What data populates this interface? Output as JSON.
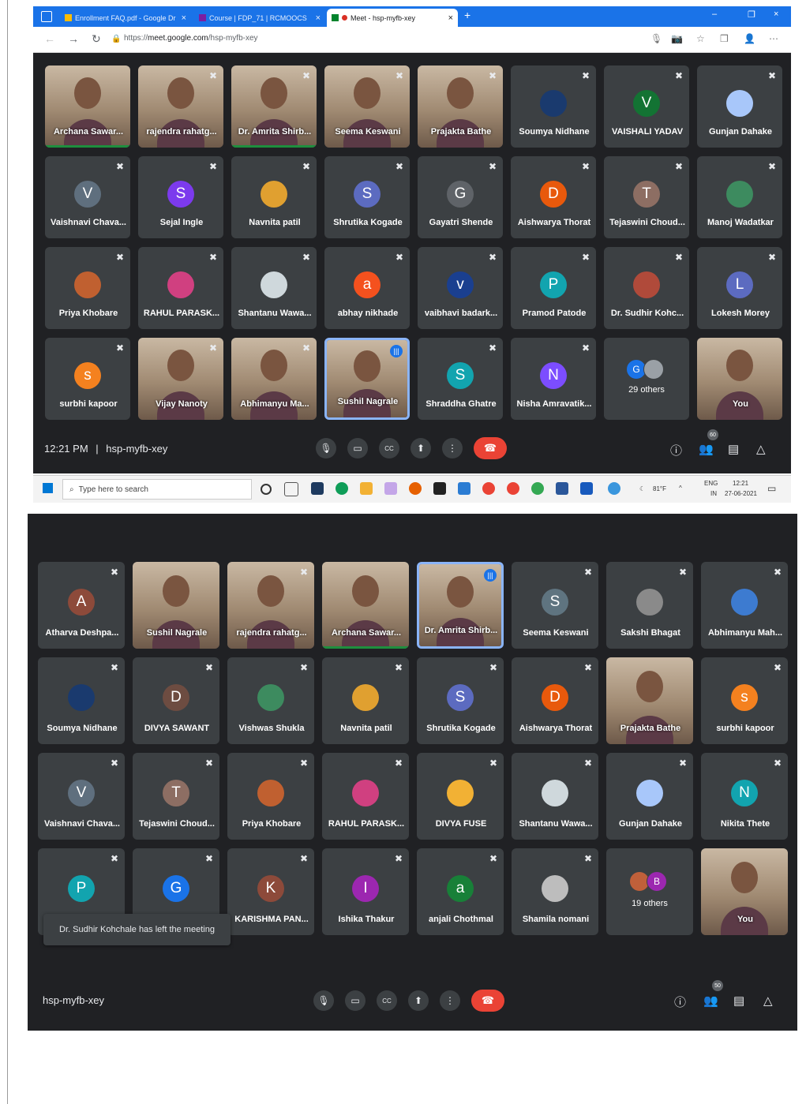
{
  "screenshot1": {
    "tabs": [
      {
        "label": "Enrollment FAQ.pdf - Google Dr",
        "close": "×"
      },
      {
        "label": "Course | FDP_71 | RCMOOCS",
        "close": "×"
      },
      {
        "label": "Meet - hsp-myfb-xey",
        "close": "×"
      }
    ],
    "new_tab": "+",
    "window_controls": [
      "–",
      "❐",
      "×"
    ],
    "url_prefix": "https://",
    "url_host": "meet.google.com",
    "url_path": "/hsp-myfb-xey",
    "tiles": [
      {
        "name": "Archana Sawar...",
        "type": "video",
        "green": true
      },
      {
        "name": "rajendra rahatg...",
        "type": "video",
        "muted": true
      },
      {
        "name": "Dr. Amrita Shirb...",
        "type": "video",
        "muted": true,
        "green": true
      },
      {
        "name": "Seema Keswani",
        "type": "video",
        "muted": true
      },
      {
        "name": "Prajakta Bathe",
        "type": "video",
        "muted": true
      },
      {
        "name": "Soumya Nidhane",
        "initial": "",
        "color": "#1a3a6e",
        "muted": true
      },
      {
        "name": "VAISHALI YADAV",
        "initial": "V",
        "color": "#137333",
        "muted": true
      },
      {
        "name": "Gunjan Dahake",
        "initial": "",
        "color": "#a8c7fa",
        "muted": true
      },
      {
        "name": "Vaishnavi Chava...",
        "initial": "V",
        "color": "#5f6f7e",
        "muted": true
      },
      {
        "name": "Sejal Ingle",
        "initial": "S",
        "color": "#7c3aed",
        "muted": true
      },
      {
        "name": "Navnita patil",
        "initial": "",
        "color": "#e0a030",
        "muted": true
      },
      {
        "name": "Shrutika Kogade",
        "initial": "S",
        "color": "#5c6bc0",
        "muted": true
      },
      {
        "name": "Gayatri Shende",
        "initial": "G",
        "color": "#5f6368",
        "muted": true
      },
      {
        "name": "Aishwarya Thorat",
        "initial": "D",
        "color": "#e8590c",
        "muted": true
      },
      {
        "name": "Tejaswini Choud...",
        "initial": "T",
        "color": "#8d6e63",
        "muted": true
      },
      {
        "name": "Manoj Wadatkar",
        "initial": "",
        "color": "#3d8b5f",
        "muted": true
      },
      {
        "name": "Priya Khobare",
        "initial": "",
        "color": "#c06030",
        "muted": true
      },
      {
        "name": "RAHUL PARASK...",
        "initial": "",
        "color": "#d04080",
        "muted": true
      },
      {
        "name": "Shantanu Wawa...",
        "initial": "",
        "color": "#cfd8dc",
        "muted": true
      },
      {
        "name": "abhay nikhade",
        "initial": "a",
        "color": "#f4511e",
        "muted": true
      },
      {
        "name": "vaibhavi badark...",
        "initial": "v",
        "color": "#1a3f8f",
        "muted": true
      },
      {
        "name": "Pramod Patode",
        "initial": "P",
        "color": "#12a4af",
        "muted": true
      },
      {
        "name": "Dr. Sudhir Kohc...",
        "initial": "",
        "color": "#b04a3a",
        "muted": true
      },
      {
        "name": "Lokesh Morey",
        "initial": "L",
        "color": "#5c6bc0",
        "muted": true
      },
      {
        "name": "surbhi kapoor",
        "initial": "s",
        "color": "#f4811f",
        "muted": true
      },
      {
        "name": "Vijay Nanoty",
        "type": "video",
        "muted": true
      },
      {
        "name": "Abhimanyu Ma...",
        "type": "video",
        "muted": true
      },
      {
        "name": "Sushil Nagrale",
        "type": "video",
        "speaking": true
      },
      {
        "name": "Shraddha Ghatre",
        "initial": "S",
        "color": "#12a4af",
        "muted": true
      },
      {
        "name": "Nisha Amravatik...",
        "initial": "N",
        "color": "#7c4dff",
        "muted": true
      },
      {
        "name": "29 others",
        "type": "others",
        "avatars": [
          {
            "letter": "G",
            "color": "#1a73e8"
          },
          {
            "letter": "",
            "color": "#9aa0a6"
          }
        ]
      },
      {
        "name": "You",
        "type": "video"
      }
    ],
    "time": "12:21 PM",
    "separator": "|",
    "meeting_code": "hsp-myfb-xey",
    "participant_count": "60",
    "taskbar": {
      "search_placeholder": "Type here to search",
      "weather": "81°F",
      "lang": "ENG",
      "region": "IN",
      "clock_time": "12:21",
      "clock_date": "27-06-2021"
    }
  },
  "screenshot2": {
    "tiles": [
      {
        "name": "Atharva Deshpa...",
        "initial": "A",
        "color": "#8d4a3a",
        "muted": true
      },
      {
        "name": "Sushil Nagrale",
        "type": "video"
      },
      {
        "name": "rajendra rahatg...",
        "type": "video",
        "muted": true
      },
      {
        "name": "Archana Sawar...",
        "type": "video",
        "green": true
      },
      {
        "name": "Dr. Amrita Shirb...",
        "type": "video",
        "speaking": true
      },
      {
        "name": "Seema Keswani",
        "initial": "S",
        "color": "#5f7480",
        "muted": true
      },
      {
        "name": "Sakshi Bhagat",
        "initial": "",
        "color": "#8a8a8a",
        "muted": true
      },
      {
        "name": "Abhimanyu Mah...",
        "initial": "",
        "color": "#3d7bd0",
        "muted": true
      },
      {
        "name": "Soumya Nidhane",
        "initial": "",
        "color": "#1a3a6e",
        "muted": true
      },
      {
        "name": "DIVYA SAWANT",
        "initial": "D",
        "color": "#6d4c41",
        "muted": true
      },
      {
        "name": "Vishwas Shukla",
        "initial": "",
        "color": "#3d8b5f",
        "muted": true
      },
      {
        "name": "Navnita patil",
        "initial": "",
        "color": "#e0a030",
        "muted": true
      },
      {
        "name": "Shrutika Kogade",
        "initial": "S",
        "color": "#5c6bc0",
        "muted": true
      },
      {
        "name": "Aishwarya Thorat",
        "initial": "D",
        "color": "#e8590c",
        "muted": true
      },
      {
        "name": "Prajakta Bathe",
        "type": "video"
      },
      {
        "name": "surbhi kapoor",
        "initial": "s",
        "color": "#f4811f",
        "muted": true
      },
      {
        "name": "Vaishnavi Chava...",
        "initial": "V",
        "color": "#5f6f7e",
        "muted": true
      },
      {
        "name": "Tejaswini Choud...",
        "initial": "T",
        "color": "#8d6e63",
        "muted": true
      },
      {
        "name": "Priya Khobare",
        "initial": "",
        "color": "#c06030",
        "muted": true
      },
      {
        "name": "RAHUL PARASK...",
        "initial": "",
        "color": "#d04080",
        "muted": true
      },
      {
        "name": "DIVYA FUSE",
        "initial": "",
        "color": "#f2b134",
        "muted": true
      },
      {
        "name": "Shantanu Wawa...",
        "initial": "",
        "color": "#cfd8dc",
        "muted": true
      },
      {
        "name": "Gunjan Dahake",
        "initial": "",
        "color": "#a8c7fa",
        "muted": true
      },
      {
        "name": "Nikita Thete",
        "initial": "N",
        "color": "#12a4af",
        "muted": true
      },
      {
        "name": "",
        "initial": "P",
        "color": "#12a4af",
        "muted": true
      },
      {
        "name": "",
        "initial": "G",
        "color": "#1a73e8",
        "muted": true
      },
      {
        "name": "KARISHMA PAN...",
        "initial": "K",
        "color": "#8d4a3a",
        "muted": true
      },
      {
        "name": "Ishika Thakur",
        "initial": "I",
        "color": "#9c27b0",
        "muted": true
      },
      {
        "name": "anjali Chothmal",
        "initial": "a",
        "color": "#188038",
        "muted": true
      },
      {
        "name": "Shamila nomani",
        "initial": "",
        "color": "#bdbdbd",
        "muted": true
      },
      {
        "name": "19 others",
        "type": "others",
        "avatars": [
          {
            "letter": "",
            "color": "#c0603a"
          },
          {
            "letter": "B",
            "color": "#9c27b0"
          }
        ]
      },
      {
        "name": "You",
        "type": "video"
      }
    ],
    "toast": "Dr. Sudhir Kohchale has left the meeting",
    "meeting_code": "hsp-myfb-xey",
    "participant_count": "50"
  },
  "icons": {
    "mic_off": "✖",
    "mic": "🎙",
    "camera": "▭",
    "captions": "CC",
    "present": "⬆",
    "more": "⋮",
    "end_call": "☎",
    "info": "ⓘ",
    "people": "👥",
    "chat": "▤",
    "activities": "△"
  }
}
